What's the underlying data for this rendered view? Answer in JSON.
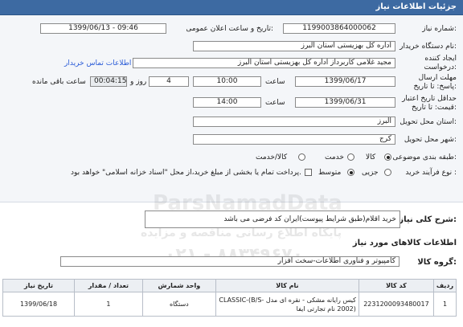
{
  "header": {
    "title": "جزئیات اطلاعات نیاز"
  },
  "form": {
    "need_number": {
      "label": "شماره نیاز:",
      "value": "1199003864000062"
    },
    "announce_datetime": {
      "label": "تاریخ و ساعت اعلان عمومی:",
      "value": "1399/06/13 - 09:46"
    },
    "buyer_org": {
      "label": "نام دستگاه خریدار:",
      "value": "اداره کل بهزیستی استان البرز"
    },
    "requester": {
      "label": "ایجاد کننده درخواست:",
      "value": "مجید غلامی کاربرداز اداره کل بهزیستی استان البرز",
      "contact_link": "اطلاعات تماس خریدار"
    },
    "reply_deadline": {
      "label": "مهلت ارسال پاسخ: تا تاریخ:",
      "date": "1399/06/17",
      "time_label": "ساعت",
      "time": "10:00",
      "days": "4",
      "days_label": "روز و",
      "remaining": "00:04:15",
      "remaining_label": "ساعت باقی مانده"
    },
    "price_validity": {
      "label": "حداقل تاریخ اعتبار قیمت: تا تاریخ:",
      "date": "1399/06/31",
      "time_label": "ساعت",
      "time": "14:00"
    },
    "province": {
      "label": "استان محل تحویل:",
      "value": "البرز"
    },
    "city": {
      "label": "شهر محل تحویل:",
      "value": "کرج"
    },
    "category": {
      "label": "طبقه بندی موضوعی:",
      "options": [
        "کالا",
        "خدمت",
        "کالا/خدمت"
      ],
      "selected": "کالا"
    },
    "purchase_process": {
      "label": "نوع فرآیند خرید :",
      "options": [
        "جزیی",
        "متوسط"
      ],
      "selected": "متوسط",
      "note": "پرداخت تمام یا بخشی از مبلغ خرید،از محل \"اسناد خزانه اسلامی\" خواهد بود."
    }
  },
  "description": {
    "label": "شرح کلی نیاز:",
    "value": "خرید اقلام(طبق شرایط پیوست)ایران کد فرضی می باشد"
  },
  "goods_section": {
    "title": "اطلاعات کالاهای مورد نیاز"
  },
  "goods_group": {
    "label": "گروه کالا:",
    "value": "کامپیوتر و فناوری اطلاعات-سخت افزار"
  },
  "table": {
    "headers": [
      "ردیف",
      "کد کالا",
      "نام کالا",
      "واحد شمارش",
      "تعداد / مقدار",
      "تاریخ نیاز"
    ],
    "rows": [
      [
        "1",
        "2231200093480017",
        "کیس رایانه مشکی - نقره ای مدل CLASSIC-(B/S-2002) نام تجارتی ایفا",
        "دستگاه",
        "1",
        "1399/06/18"
      ]
    ]
  },
  "watermark": {
    "brand": "ParsNamadData",
    "line1": "پایگاه اطلاع رسانی مناقصه و مزایده",
    "phone": "۰۲۱ - ۸۸۳۴۹۶۷۰"
  }
}
